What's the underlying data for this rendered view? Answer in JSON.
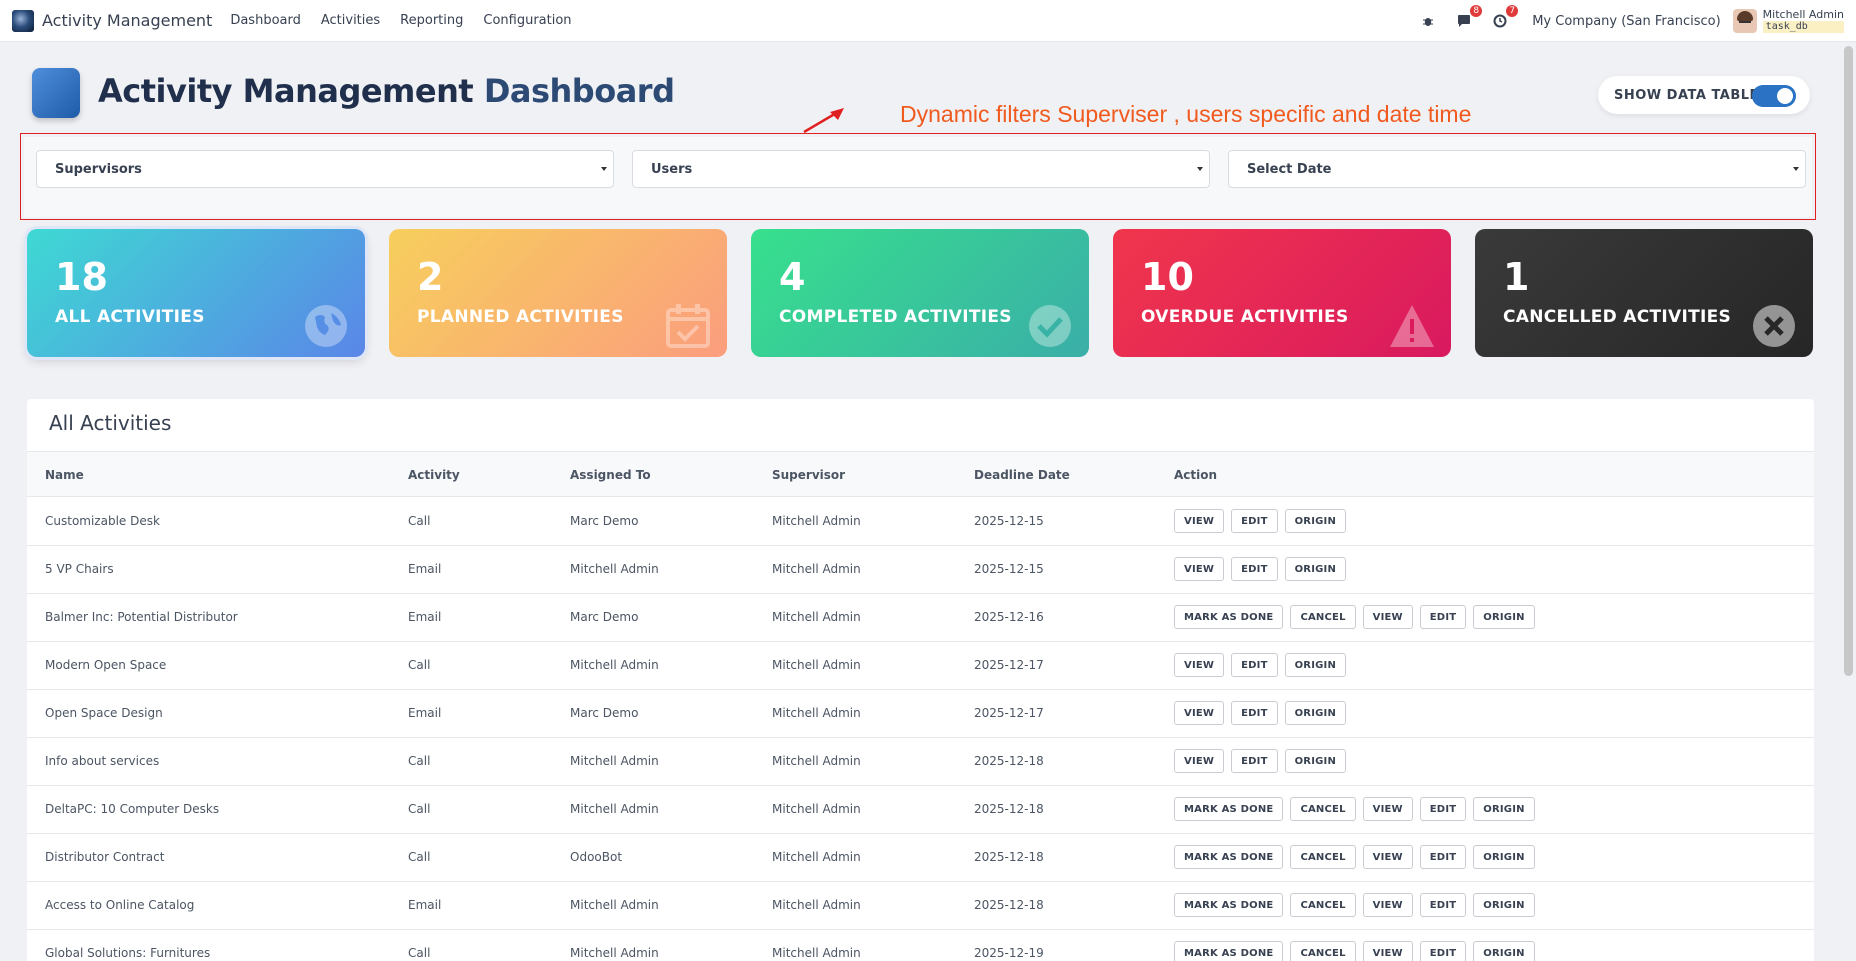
{
  "navbar": {
    "app_title": "Activity Management",
    "menu": [
      "Dashboard",
      "Activities",
      "Reporting",
      "Configuration"
    ],
    "messages_count": "8",
    "activities_count": "7",
    "company": "My Company (San Francisco)",
    "user_name": "Mitchell Admin",
    "db_name": "task_db",
    "icons": [
      "bug-icon",
      "chat-icon",
      "clock-icon"
    ]
  },
  "header": {
    "title_main": "Activity Management",
    "title_accent": "Dashboard",
    "toggle_label": "SHOW DATA TABLE",
    "toggle_on": true
  },
  "annotation": "Dynamic filters  Superviser , users  specific and date time",
  "filters": {
    "supervisors": "Supervisors",
    "users": "Users",
    "date": "Select Date"
  },
  "kpis": [
    {
      "value": "18",
      "label": "ALL ACTIVITIES",
      "icon": "globe-icon"
    },
    {
      "value": "2",
      "label": "PLANNED ACTIVITIES",
      "icon": "calendar-check-icon"
    },
    {
      "value": "4",
      "label": "COMPLETED ACTIVITIES",
      "icon": "check-circle-icon"
    },
    {
      "value": "10",
      "label": "OVERDUE ACTIVITIES",
      "icon": "warning-icon"
    },
    {
      "value": "1",
      "label": "CANCELLED ACTIVITIES",
      "icon": "x-circle-icon"
    }
  ],
  "table": {
    "title": "All Activities",
    "columns": [
      "Name",
      "Activity",
      "Assigned To",
      "Supervisor",
      "Deadline Date",
      "Action"
    ],
    "button_labels": {
      "mark_done": "MARK AS DONE",
      "cancel": "CANCEL",
      "view": "VIEW",
      "edit": "EDIT",
      "origin": "ORIGIN"
    },
    "rows": [
      {
        "name": "Customizable Desk",
        "activity": "Call",
        "assigned": "Marc Demo",
        "supervisor": "Mitchell Admin",
        "deadline": "2025-12-15",
        "full_actions": false
      },
      {
        "name": "5 VP Chairs",
        "activity": "Email",
        "assigned": "Mitchell Admin",
        "supervisor": "Mitchell Admin",
        "deadline": "2025-12-15",
        "full_actions": false
      },
      {
        "name": "Balmer Inc: Potential Distributor",
        "activity": "Email",
        "assigned": "Marc Demo",
        "supervisor": "Mitchell Admin",
        "deadline": "2025-12-16",
        "full_actions": true
      },
      {
        "name": "Modern Open Space",
        "activity": "Call",
        "assigned": "Mitchell Admin",
        "supervisor": "Mitchell Admin",
        "deadline": "2025-12-17",
        "full_actions": false
      },
      {
        "name": "Open Space Design",
        "activity": "Email",
        "assigned": "Marc Demo",
        "supervisor": "Mitchell Admin",
        "deadline": "2025-12-17",
        "full_actions": false
      },
      {
        "name": "Info about services",
        "activity": "Call",
        "assigned": "Mitchell Admin",
        "supervisor": "Mitchell Admin",
        "deadline": "2025-12-18",
        "full_actions": false
      },
      {
        "name": "DeltaPC: 10 Computer Desks",
        "activity": "Call",
        "assigned": "Mitchell Admin",
        "supervisor": "Mitchell Admin",
        "deadline": "2025-12-18",
        "full_actions": true
      },
      {
        "name": "Distributor Contract",
        "activity": "Call",
        "assigned": "OdooBot",
        "supervisor": "Mitchell Admin",
        "deadline": "2025-12-18",
        "full_actions": true
      },
      {
        "name": "Access to Online Catalog",
        "activity": "Email",
        "assigned": "Mitchell Admin",
        "supervisor": "Mitchell Admin",
        "deadline": "2025-12-18",
        "full_actions": true
      },
      {
        "name": "Global Solutions: Furnitures",
        "activity": "Call",
        "assigned": "Mitchell Admin",
        "supervisor": "Mitchell Admin",
        "deadline": "2025-12-19",
        "full_actions": true
      }
    ]
  }
}
